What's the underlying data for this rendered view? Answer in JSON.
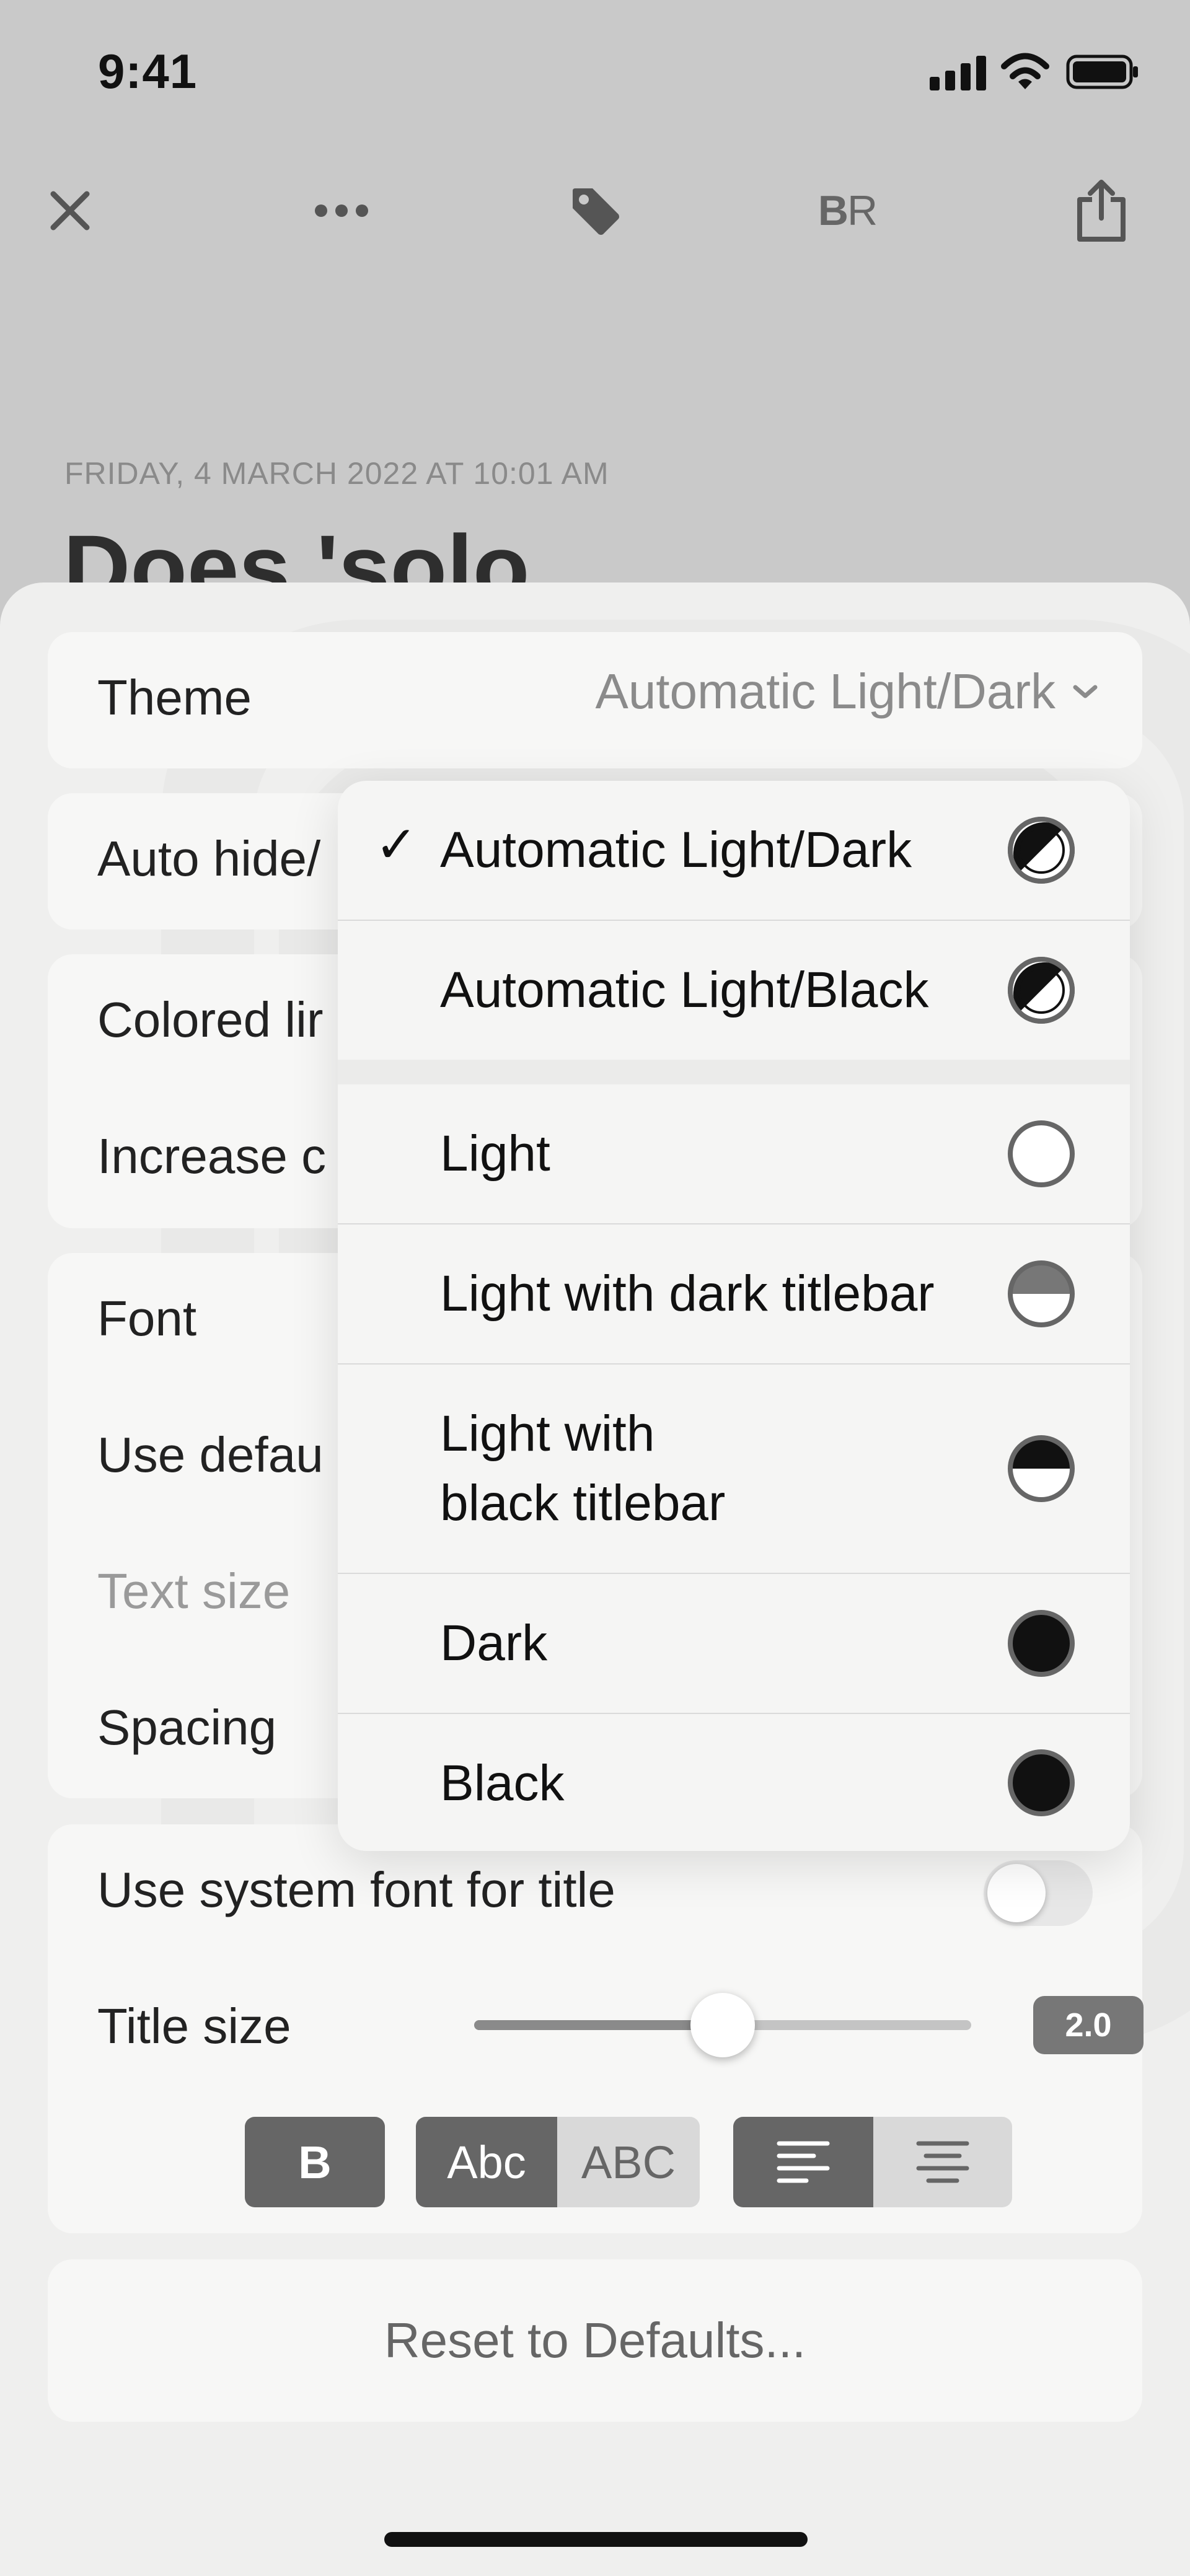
{
  "status_bar": {
    "time": "9:41"
  },
  "toolbar": {
    "close_icon": "close-icon",
    "more_icon": "ellipsis-icon",
    "tag_icon": "tag-icon",
    "reader_label_bold": "B",
    "reader_label_regular": "R",
    "share_icon": "share-icon"
  },
  "note": {
    "date": "FRIDAY, 4 MARCH 2022 AT 10:01 AM",
    "title": "Does 'solo"
  },
  "settings": {
    "theme": {
      "label": "Theme",
      "value": "Automatic Light/Dark"
    },
    "auto_hide": {
      "label": "Auto hide/"
    },
    "colored_lines": {
      "label": "Colored lir"
    },
    "increase_contrast": {
      "label": "Increase c"
    },
    "font": {
      "label": "Font"
    },
    "use_default": {
      "label": "Use defau"
    },
    "text_size": {
      "label": "Text size"
    },
    "spacing": {
      "label": "Spacing"
    },
    "system_font_title": {
      "label": "Use system font for title",
      "on": false
    },
    "title_size": {
      "label": "Title size",
      "value": "2.0",
      "level_fraction": 0.5
    },
    "format_buttons": {
      "bold": "B",
      "capitalized": "Abc",
      "uppercase": "ABC"
    },
    "reset": {
      "label": "Reset to Defaults..."
    }
  },
  "theme_menu": {
    "items": [
      {
        "label": "Automatic Light/Dark",
        "selected": true,
        "icon": "auto-half-icon"
      },
      {
        "label": "Automatic Light/Black",
        "selected": false,
        "icon": "auto-half-icon"
      },
      {
        "label": "Light",
        "selected": false,
        "icon": "empty-circle-icon"
      },
      {
        "label": "Light with dark titlebar",
        "selected": false,
        "icon": "top-half-gray-circle-icon"
      },
      {
        "label_line1": "Light with",
        "label_line2": "black titlebar",
        "selected": false,
        "icon": "top-half-black-circle-icon"
      },
      {
        "label": "Dark",
        "selected": false,
        "icon": "filled-circle-icon"
      },
      {
        "label": "Black",
        "selected": false,
        "icon": "filled-circle-icon"
      }
    ],
    "check_mark": "✓"
  },
  "colors": {
    "accent_gray": "#666666",
    "badge": "#777777",
    "sheet": "#efefee"
  }
}
